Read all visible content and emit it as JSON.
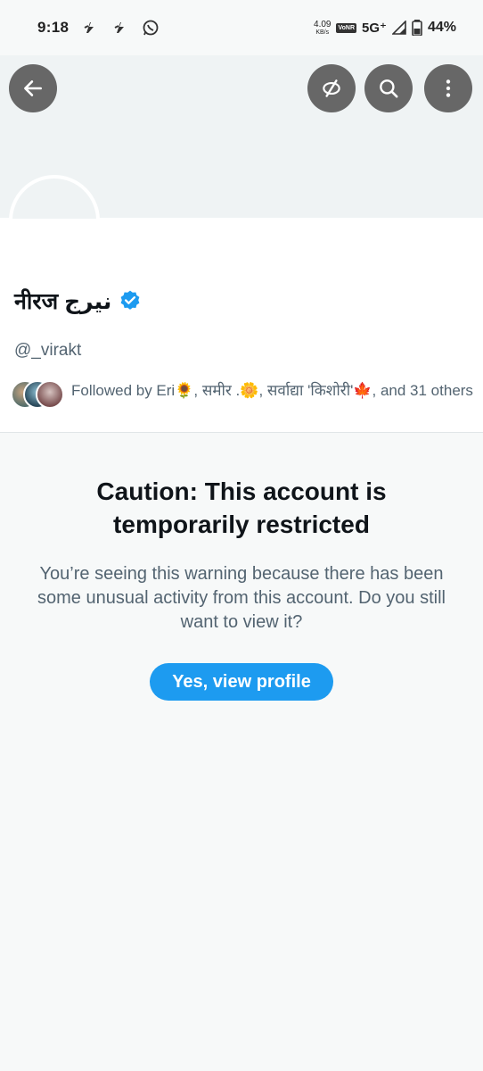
{
  "status_bar": {
    "time": "9:18",
    "net_speed_value": "4.09",
    "net_speed_unit": "KB/s",
    "vonr": "VoNR",
    "network": "5G⁺",
    "battery": "44%"
  },
  "header": {
    "back_icon": "arrow-left-icon",
    "translate_icon": "translate-off-icon",
    "search_icon": "search-icon",
    "more_icon": "more-vertical-icon"
  },
  "profile": {
    "display_name": "नीरज نیرج",
    "handle": "@_virakt",
    "followed_by": "Followed by Eri🌻, समीर .🌼, सर्वाद्या 'किशोरी'🍁, and 31 others",
    "verified_color": "#1d9bf0"
  },
  "caution": {
    "title": "Caution: This account is temporarily restricted",
    "body": "You’re seeing this warning because there has been some unusual activity from this account. Do you still want to view it?",
    "button_label": "Yes, view profile"
  },
  "colors": {
    "accent": "#1d9bf0",
    "text_primary": "#0f1419",
    "text_secondary": "#536471"
  }
}
